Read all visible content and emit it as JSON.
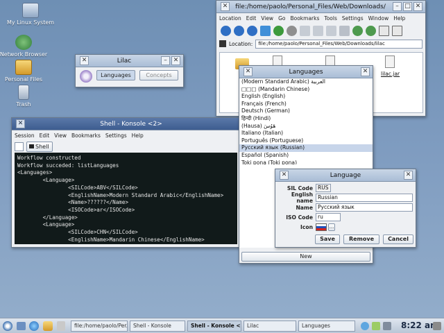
{
  "desktop": {
    "icons": [
      {
        "label": "My Linux System"
      },
      {
        "label": "Network Browser"
      },
      {
        "label": "Personal Files"
      },
      {
        "label": "Trash"
      }
    ]
  },
  "browser": {
    "title": "file:/home/paolo/Personal_Files/Web/Downloads/",
    "menu": [
      "Location",
      "Edit",
      "View",
      "Go",
      "Bookmarks",
      "Tools",
      "Settings",
      "Window",
      "Help"
    ],
    "location_label": "Location:",
    "location_value": "file:/home/paolo/Personal_Files/Web/Downloads/lilac",
    "file_label": "lilac.jar"
  },
  "lilac": {
    "title": "Lilac",
    "tab_languages": "Languages",
    "tab_concepts": "Concepts"
  },
  "konsole": {
    "title": "Shell - Konsole <2>",
    "menu": [
      "Session",
      "Edit",
      "View",
      "Bookmarks",
      "Settings",
      "Help"
    ],
    "tab_label": "Shell",
    "lines": [
      "Workflow constructed",
      "Workflow succeded: listLanguages",
      "<Languages>",
      "        <Language>",
      "                <SILCode>ABV</SILCode>",
      "                <EnglishName>Modern Standard Arabic</EnglishName>",
      "                <Name>??????</Name>",
      "                <ISOCode>ar</ISOCode>",
      "        </Language>",
      "        <Language>",
      "                <SILCode>CHN</SILCode>",
      "                <EnglishName>Mandarin Chinese</EnglishName>"
    ]
  },
  "languages_window": {
    "title": "Languages",
    "items": [
      "(Modern Standard Arabic) العربية",
      "□□□ (Mandarin Chinese)",
      "English (English)",
      "Français (French)",
      "Deutsch (German)",
      "हिन्दी (Hindi)",
      "(Hausa) هَوُسَ",
      "Italiano (Italian)",
      "Português (Portuguese)",
      "Русский язык (Russian)",
      "Español (Spanish)",
      "Toki pona (Toki pona)"
    ],
    "selected_index": 9,
    "new_button": "New"
  },
  "language_dialog": {
    "title": "Language",
    "sil_code_label": "SIL Code",
    "sil_code": "RUS",
    "english_name_label": "English name",
    "english_name": "Russian",
    "name_label": "Name",
    "name": "Русский язык",
    "iso_code_label": "ISO Code",
    "iso_code": "ru",
    "icon_label": "Icon",
    "icon_button": "...",
    "save": "Save",
    "remove": "Remove",
    "cancel": "Cancel"
  },
  "taskbar": {
    "tasks": [
      {
        "label": "file:/home/paolo/Per..."
      },
      {
        "label": "Shell - Konsole"
      },
      {
        "label": "Shell - Konsole <2>"
      },
      {
        "label": "Lilac"
      },
      {
        "label": "Languages"
      }
    ],
    "clock": "8:22 am"
  },
  "colors": {
    "desktop": "#7f9cc0",
    "title_active": "#3e5d90",
    "terminal_bg": "#111a1a",
    "selection": "#c7d5ea"
  }
}
